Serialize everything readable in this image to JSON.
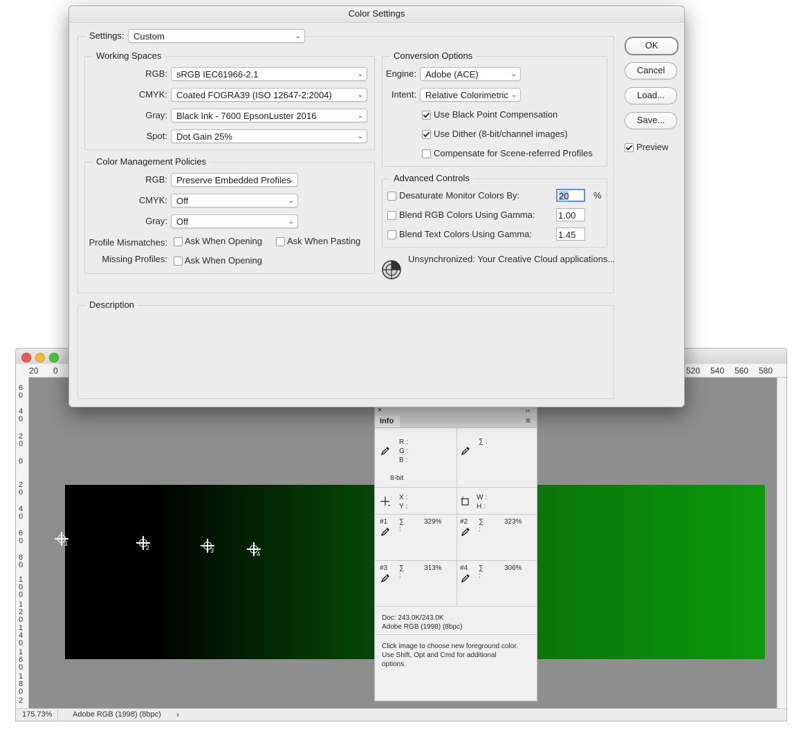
{
  "document": {
    "ruler_top": {
      "left": [
        "20",
        "0"
      ],
      "right": [
        "520",
        "540",
        "560",
        "580"
      ]
    },
    "ruler_left": [
      "6 0",
      "4 0",
      "2 0",
      "0",
      "2 0",
      "4 0",
      "6 0",
      "8 0",
      "1 0 0",
      "1 2 0",
      "1 4 0",
      "1 6 0",
      "1 8 0",
      "2"
    ],
    "samplers": [
      "1",
      "2",
      "3",
      "4"
    ],
    "status": {
      "zoom": "175.73%",
      "profile": "Adobe RGB (1998) (8bpc)",
      "arrow": "›"
    }
  },
  "info_panel": {
    "tab": "Info",
    "close": "×",
    "collapse": "‹‹",
    "menu": "≡",
    "rgb_labels": [
      "R :",
      "G :",
      "B :"
    ],
    "sigma": "∑ :",
    "bit_depth": "8-bit",
    "xy_labels": [
      "X :",
      "Y :"
    ],
    "wh_labels": [
      "W :",
      "H :"
    ],
    "samples": [
      {
        "id": "#1",
        "value": "329%"
      },
      {
        "id": "#2",
        "value": "323%"
      },
      {
        "id": "#3",
        "value": "313%"
      },
      {
        "id": "#4",
        "value": "306%"
      }
    ],
    "doc_size": "Doc: 243.0K/243.0K",
    "doc_profile": "Adobe RGB (1998) (8bpc)",
    "hint": "Click image to choose new foreground color.  Use Shift, Opt and Cmd for additional options."
  },
  "dialog": {
    "title": "Color Settings",
    "settings_label": "Settings:",
    "settings_value": "Custom",
    "working_spaces": {
      "legend": "Working Spaces",
      "rows": [
        {
          "label": "RGB:",
          "value": "sRGB IEC61966-2.1"
        },
        {
          "label": "CMYK:",
          "value": "Coated FOGRA39 (ISO 12647-2:2004)"
        },
        {
          "label": "Gray:",
          "value": "Black Ink - 7600 EpsonLuster 2016"
        },
        {
          "label": "Spot:",
          "value": "Dot Gain 25%"
        }
      ]
    },
    "policies": {
      "legend": "Color Management Policies",
      "rows": [
        {
          "label": "RGB:",
          "value": "Preserve Embedded Profiles"
        },
        {
          "label": "CMYK:",
          "value": "Off"
        },
        {
          "label": "Gray:",
          "value": "Off"
        }
      ],
      "mismatch_label": "Profile Mismatches:",
      "ask_opening": "Ask When Opening",
      "ask_pasting": "Ask When Pasting",
      "missing_label": "Missing Profiles:",
      "missing_ask_opening": "Ask When Opening"
    },
    "conversion": {
      "legend": "Conversion Options",
      "engine_label": "Engine:",
      "engine_value": "Adobe (ACE)",
      "intent_label": "Intent:",
      "intent_value": "Relative Colorimetric",
      "black_point": "Use Black Point Compensation",
      "dither": "Use Dither (8-bit/channel images)",
      "scene": "Compensate for Scene-referred Profiles"
    },
    "advanced": {
      "legend": "Advanced Controls",
      "desaturate": "Desaturate Monitor Colors By:",
      "desaturate_value": "20",
      "percent": "%",
      "blend_rgb": "Blend RGB Colors Using Gamma:",
      "blend_rgb_value": "1.00",
      "blend_text": "Blend Text Colors Using Gamma:",
      "blend_text_value": "1.45"
    },
    "sync_text": "Unsynchronized: Your Creative Cloud applications...",
    "description_legend": "Description",
    "buttons": {
      "ok": "OK",
      "cancel": "Cancel",
      "load": "Load...",
      "save": "Save..."
    },
    "preview": "Preview",
    "chevron": "⌄"
  }
}
